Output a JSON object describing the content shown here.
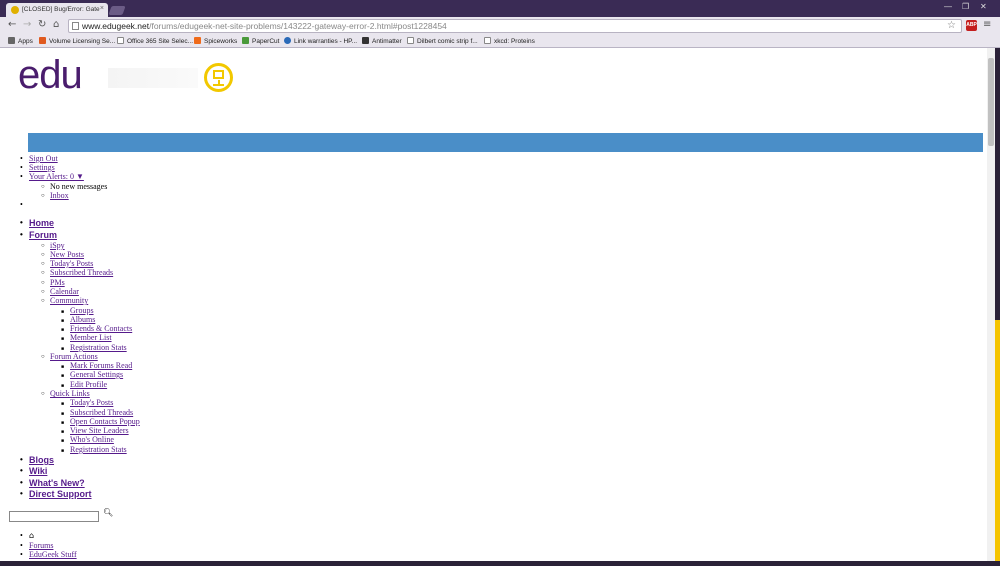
{
  "browser": {
    "tab_title": "[CLOSED] Bug/Error: Gate",
    "url_host": "www.edugeek.net",
    "url_path": "/forums/edugeek-net-site-problems/143222-gateway-error-2.html#post1228454",
    "back_icon": "←",
    "forward_icon": "→",
    "reload_icon": "↻",
    "home_icon": "⌂",
    "star_icon": "☆",
    "menu_icon": "≡",
    "extension_label": "ABP",
    "window_controls": [
      "—",
      "❐",
      "✕"
    ],
    "bookmarks": [
      {
        "label": "Apps",
        "color": "#666"
      },
      {
        "label": "Volume Licensing Se...",
        "color": "#e05a1f"
      },
      {
        "label": "Office 365 Site Selec...",
        "color": "#ffffff"
      },
      {
        "label": "Spiceworks",
        "color": "#ef6a1a"
      },
      {
        "label": "PaperCut",
        "color": "#4a9a3a"
      },
      {
        "label": "Link warranties - HP...",
        "color": "#2a6ab8"
      },
      {
        "label": "Antimatter",
        "color": "#333333"
      },
      {
        "label": "Dilbert comic strip f...",
        "color": "#ffffff"
      },
      {
        "label": "xkcd: Proteins",
        "color": "#ffffff"
      }
    ]
  },
  "logo": {
    "text": "edu"
  },
  "user_menu": {
    "sign_out": "Sign Out",
    "settings": "Settings",
    "alerts": "Your Alerts: 0 ▼",
    "no_messages": "No new messages",
    "inbox": "Inbox"
  },
  "main_nav": {
    "home": "Home",
    "forum": "Forum",
    "forum_sub": [
      {
        "label": "iSpy"
      },
      {
        "label": "New Posts"
      },
      {
        "label": "Today's Posts"
      },
      {
        "label": "Subscribed Threads"
      },
      {
        "label": "PMs"
      },
      {
        "label": "Calendar"
      },
      {
        "label": "Community"
      }
    ],
    "community_sub": [
      "Groups",
      "Albums",
      "Friends & Contacts",
      "Member List",
      "Registration Stats"
    ],
    "forum_actions": "Forum Actions",
    "forum_actions_sub": [
      "Mark Forums Read",
      "General Settings",
      "Edit Profile"
    ],
    "quick_links": "Quick Links",
    "quick_links_sub": [
      "Today's Posts",
      "Subscribed Threads",
      "Open Contacts Popup",
      "View Site Leaders",
      "Who's Online",
      "Registration Stats"
    ],
    "blogs": "Blogs",
    "wiki": "Wiki",
    "whats_new": "What's New?",
    "direct_support": "Direct Support"
  },
  "search": {
    "icon": "🔍"
  },
  "breadcrumb": {
    "home_icon": "⌂",
    "forums": "Forums",
    "edugeek_stuff": "EduGeek Stuff"
  }
}
